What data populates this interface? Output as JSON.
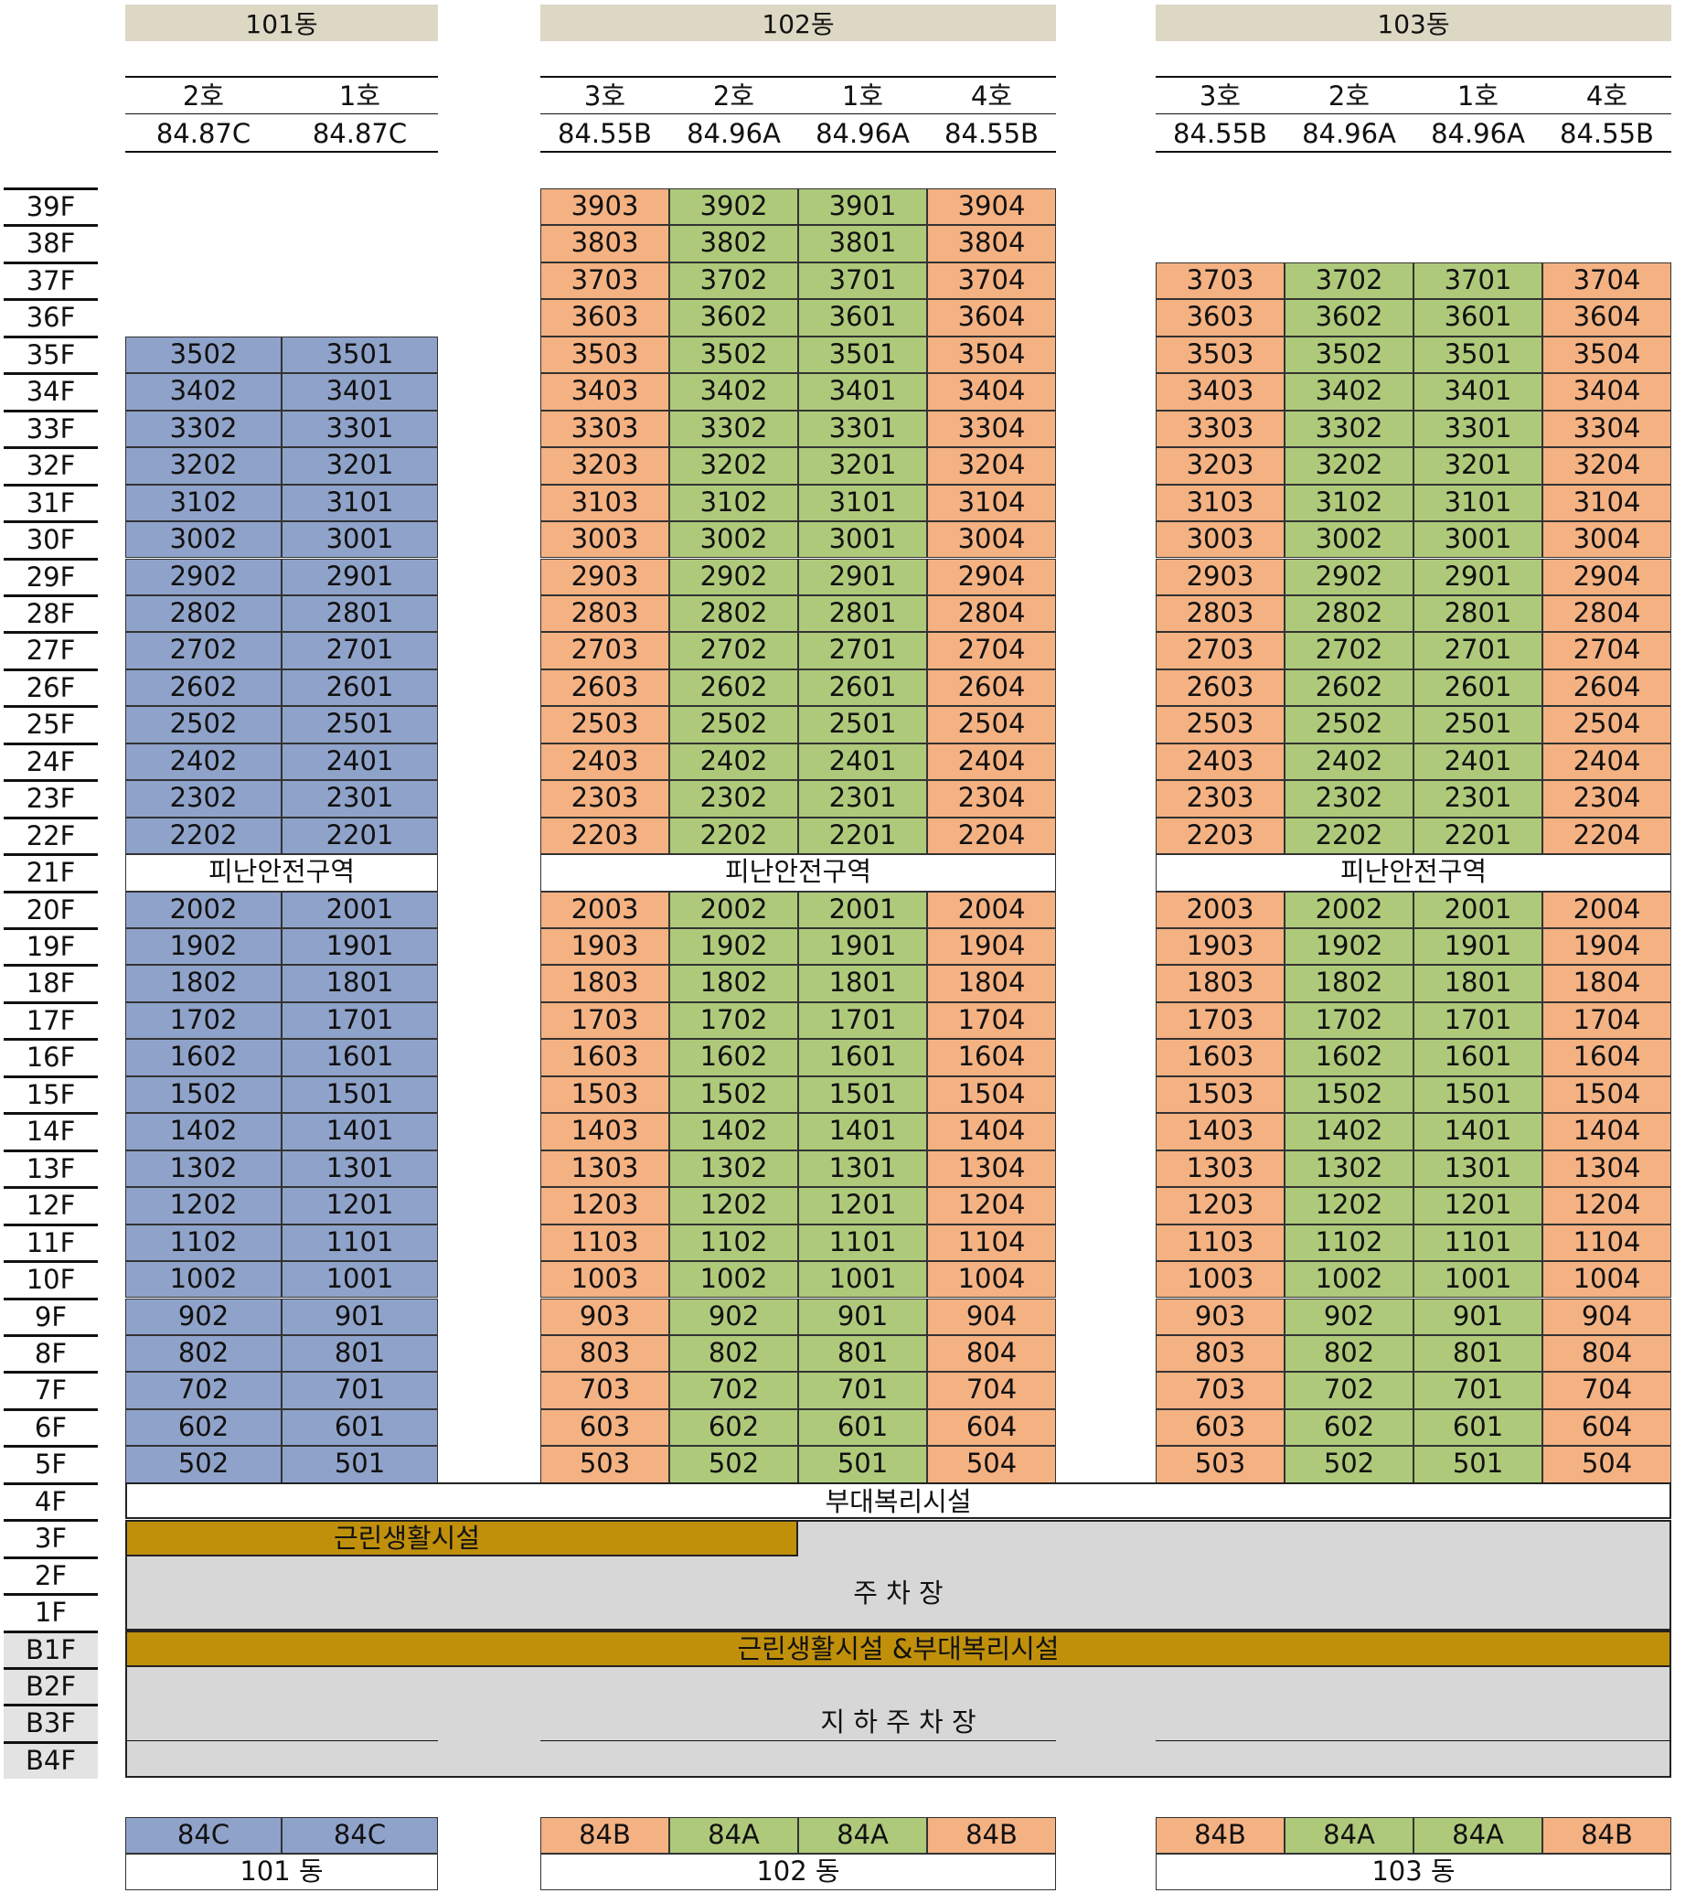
{
  "buildings": [
    {
      "name": "101동",
      "units": [
        "2호",
        "1호"
      ],
      "areas": [
        "84.87C",
        "84.87C"
      ],
      "cols": [
        "02",
        "01"
      ],
      "color_classes": [
        "c-blue",
        "c-blue"
      ],
      "top_floor": 35,
      "types": [
        "84C",
        "84C"
      ],
      "footer": "101 동"
    },
    {
      "name": "102동",
      "units": [
        "3호",
        "2호",
        "1호",
        "4호"
      ],
      "areas": [
        "84.55B",
        "84.96A",
        "84.96A",
        "84.55B"
      ],
      "cols": [
        "03",
        "02",
        "01",
        "04"
      ],
      "color_classes": [
        "c-orange",
        "c-green",
        "c-green",
        "c-orange"
      ],
      "top_floor": 39,
      "types": [
        "84B",
        "84A",
        "84A",
        "84B"
      ],
      "footer": "102 동"
    },
    {
      "name": "103동",
      "units": [
        "3호",
        "2호",
        "1호",
        "4호"
      ],
      "areas": [
        "84.55B",
        "84.96A",
        "84.96A",
        "84.55B"
      ],
      "cols": [
        "03",
        "02",
        "01",
        "04"
      ],
      "color_classes": [
        "c-orange",
        "c-green",
        "c-green",
        "c-orange"
      ],
      "top_floor": 37,
      "types": [
        "84B",
        "84A",
        "84A",
        "84B"
      ],
      "footer": "103 동"
    }
  ],
  "floor_labels": [
    "39F",
    "38F",
    "37F",
    "36F",
    "35F",
    "34F",
    "33F",
    "32F",
    "31F",
    "30F",
    "29F",
    "28F",
    "27F",
    "26F",
    "25F",
    "24F",
    "23F",
    "22F",
    "21F",
    "20F",
    "19F",
    "18F",
    "17F",
    "16F",
    "15F",
    "14F",
    "13F",
    "12F",
    "11F",
    "10F",
    "9F",
    "8F",
    "7F",
    "6F",
    "5F",
    "4F",
    "3F",
    "2F",
    "1F",
    "B1F",
    "B2F",
    "B3F",
    "B4F"
  ],
  "basement_labels": [
    "B1F",
    "B2F",
    "B3F",
    "B4F"
  ],
  "refuge_floor": 21,
  "refuge_label": "피난안전구역",
  "podium": {
    "floor4": "부대복리시설",
    "floor3": "근린생활시설",
    "parking": "주 차 장",
    "b1": "근린생활시설 &부대복리시설",
    "basement_parking": "지 하 주 차 장"
  },
  "colors": {
    "type_C": "#8fa2c9",
    "type_B": "#f4b182",
    "type_A": "#aec97a",
    "commercial": "#c0900b",
    "parking": "#d7d7d7",
    "header": "#ddd8c4"
  }
}
